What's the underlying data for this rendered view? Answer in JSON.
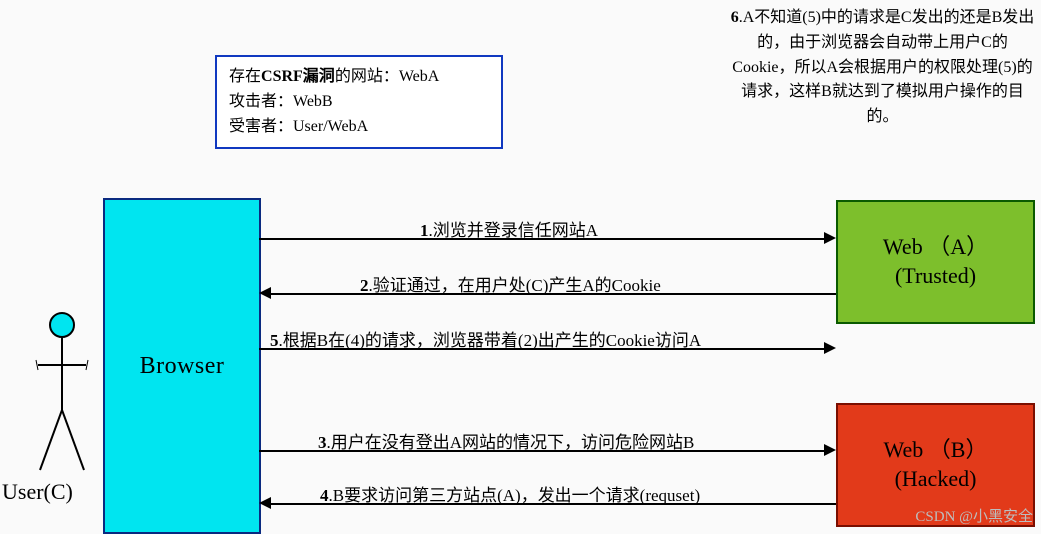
{
  "info": {
    "line1a": "存在",
    "line1b": "CSRF漏洞",
    "line1c": "的网站：WebA",
    "line2": "攻击者：WebB",
    "line3": "受害者：User/WebA"
  },
  "note6": {
    "n": "6",
    "text": ".A不知道(5)中的请求是C发出的还是B发出的，由于浏览器会自动带上用户C的Cookie，所以A会根据用户的权限处理(5)的请求，这样B就达到了模拟用户操作的目的。"
  },
  "boxes": {
    "browser": "Browser",
    "webA1": "Web （A）",
    "webA2": "(Trusted)",
    "webB1": "Web （B）",
    "webB2": "(Hacked)"
  },
  "user": {
    "label": "User(C)"
  },
  "flows": {
    "s1": {
      "n": "1",
      "t": ".浏览并登录信任网站A"
    },
    "s2": {
      "n": "2",
      "t": ".验证通过，在用户处(C)产生A的Cookie"
    },
    "s5": {
      "n": "5",
      "t": ".根据B在(4)的请求，浏览器带着(2)出产生的Cookie访问A"
    },
    "s3": {
      "n": "3",
      "t": ".用户在没有登出A网站的情况下，访问危险网站B"
    },
    "s4": {
      "n": "4",
      "t": ".B要求访问第三方站点(A)，发出一个请求(requset)"
    }
  },
  "watermark": "CSDN @小黑安全"
}
